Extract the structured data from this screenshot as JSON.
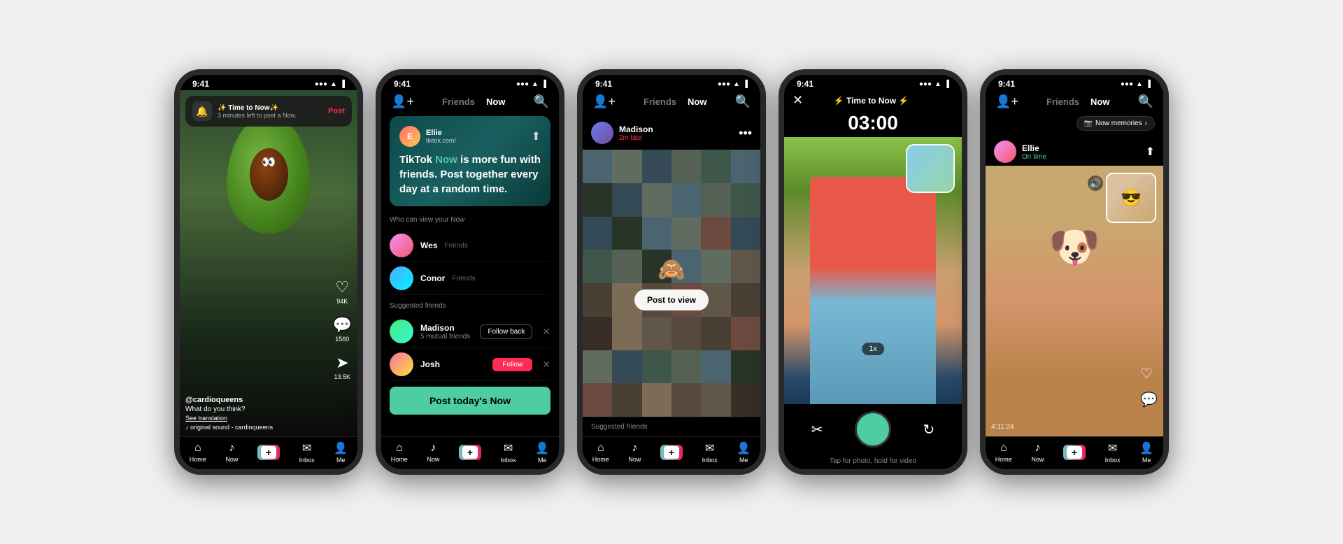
{
  "phones": {
    "phone1": {
      "statusTime": "9:41",
      "notification": {
        "icon": "🔔",
        "title": "✨ Time to Now✨",
        "subtitle": "3 minutes left to post a Now.",
        "action": "Post"
      },
      "user": "@cardioqueens",
      "caption": "What do you think?",
      "translation": "See translation",
      "sound": "♪ original sound - cardioqueens",
      "likes": "94K",
      "comments": "1560",
      "shares": "13.5K",
      "nav": [
        "Home",
        "Now",
        "+",
        "Inbox",
        "Me"
      ]
    },
    "phone2": {
      "statusTime": "9:41",
      "tabs": [
        "Friends",
        "Now"
      ],
      "activeTab": "Now",
      "promo": {
        "username": "Ellie",
        "handle": "tiktok.com/",
        "text1": "TikTok ",
        "nowHighlight": "Now",
        "text2": " is more fun with friends. Post together every day at a random time."
      },
      "sectionTitle": "Who can view your Now",
      "friends": [
        {
          "name": "Wes",
          "tag": "Friends",
          "avatar": "wes"
        },
        {
          "name": "Conor",
          "tag": "Friends",
          "avatar": "conor"
        }
      ],
      "suggestedTitle": "Suggested friends",
      "suggested": [
        {
          "name": "Madison",
          "sub": "5 mutual friends",
          "action": "Follow back",
          "avatar": "madison"
        },
        {
          "name": "Josh",
          "action": "Follow",
          "avatar": "josh"
        }
      ],
      "postBtn": "Post today's Now"
    },
    "phone3": {
      "statusTime": "9:41",
      "tabs": [
        "Friends",
        "Now"
      ],
      "activeTab": "Now",
      "user": "Madison",
      "late": "2m late",
      "overlayEmoji": "🙈",
      "overlayBtn": "Post to view",
      "suggestedBar": "Suggested friends"
    },
    "phone4": {
      "statusTime": "9:41",
      "title1": "⚡ Time to Now ⚡",
      "timer": "03:00",
      "zoomLevel": "1x",
      "hint": "Tap for photo, hold for video",
      "controls": [
        "✂️",
        "🔵",
        "↻"
      ]
    },
    "phone5": {
      "statusTime": "9:41",
      "tabs": [
        "Friends",
        "Now"
      ],
      "activeTab": "Now",
      "memoriesBtn": "Now memories",
      "memoriesIcon": "📷",
      "user": "Ellie",
      "status": "On time",
      "timestamp": "4:11:24",
      "soundIcon": "🔊"
    }
  }
}
